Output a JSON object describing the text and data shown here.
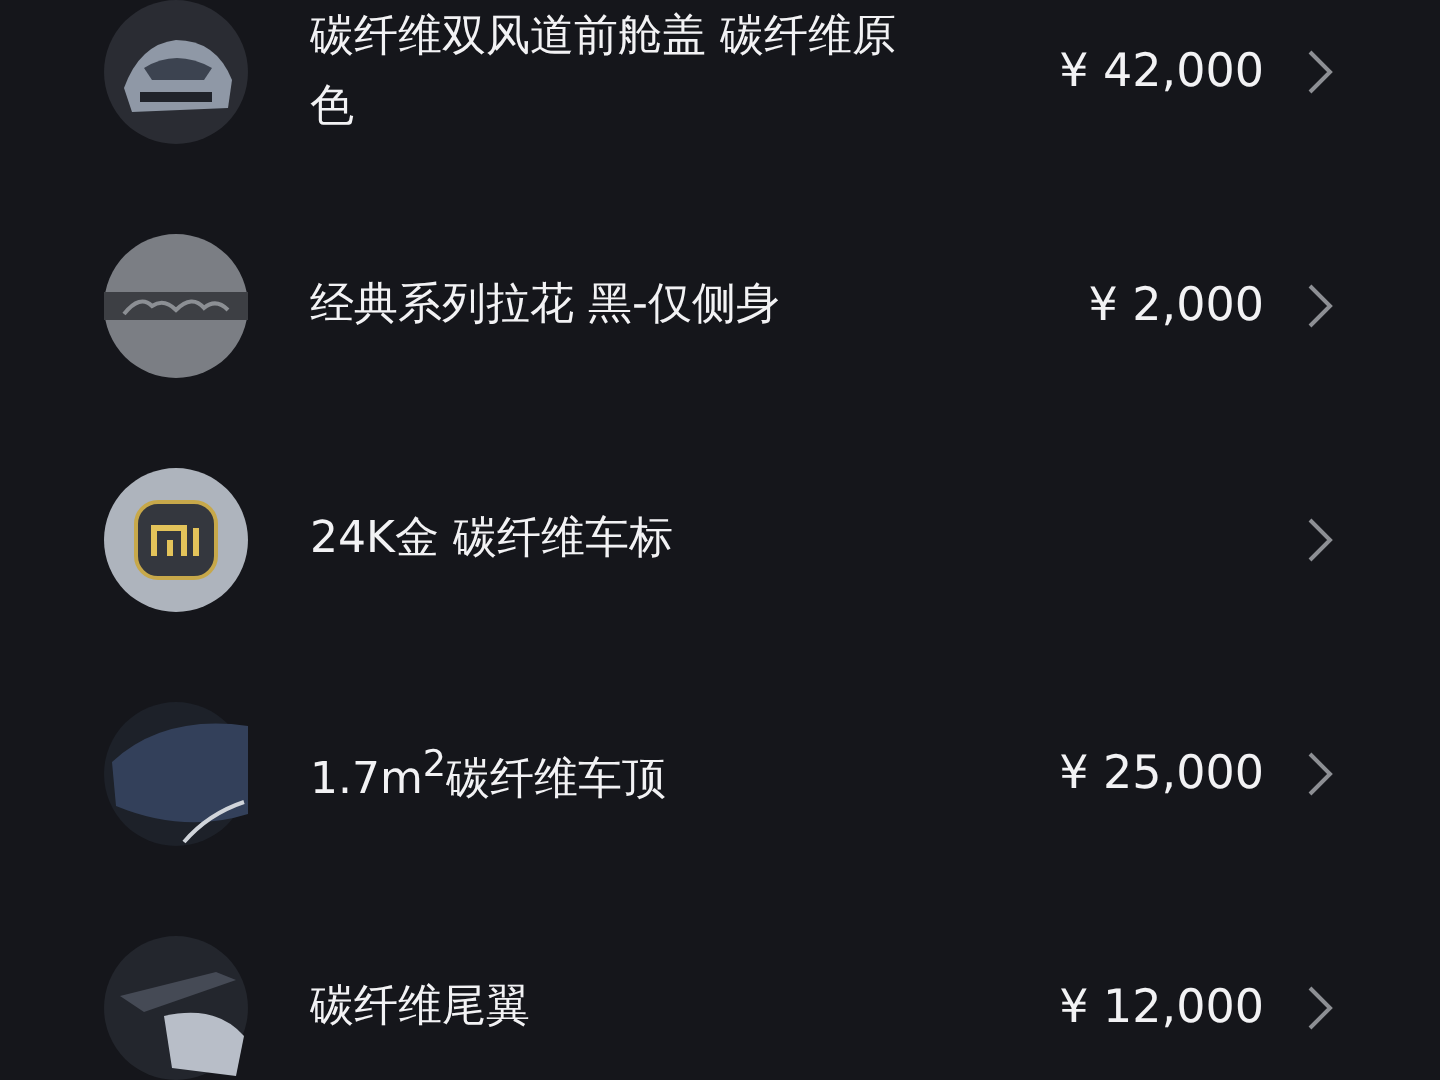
{
  "items": [
    {
      "kind": "car",
      "title": "碳纤维双风道前舱盖 碳纤维原色",
      "price": "¥ 42,000"
    },
    {
      "kind": "badge",
      "title": "经典系列拉花 黑-仅侧身",
      "price": "¥ 2,000"
    },
    {
      "kind": "logo",
      "title": "24K金 碳纤维车标"
    },
    {
      "kind": "roof",
      "title": "1.7m$^{2}$碳纤维车顶",
      "price": "¥ 25,000"
    },
    {
      "kind": "wing",
      "title": "碳纤维尾翼",
      "price": "¥ 12,000"
    }
  ]
}
